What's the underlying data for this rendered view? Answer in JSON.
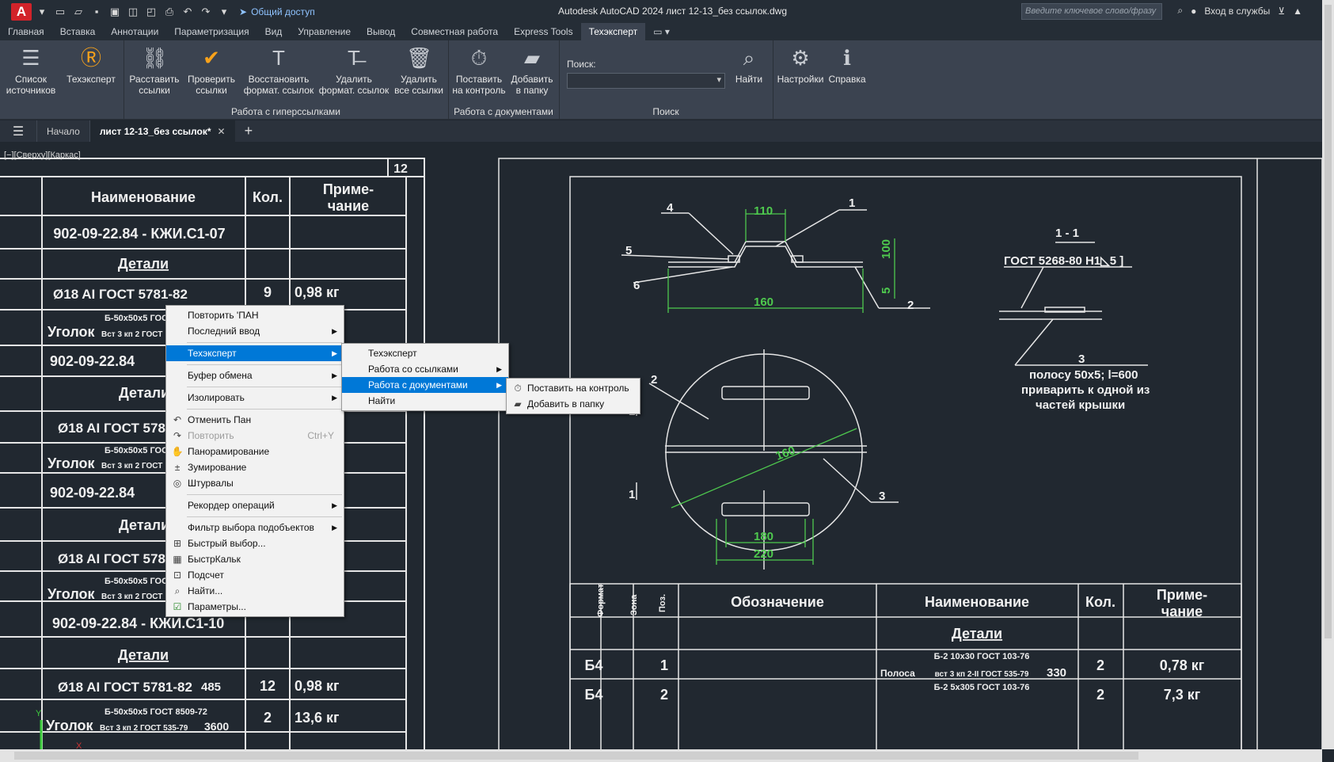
{
  "titlebar": {
    "logo": "A",
    "share_label": "Общий доступ",
    "title": "Autodesk AutoCAD 2024   лист 12-13_без ссылок.dwg",
    "search_placeholder": "Введите ключевое слово/фразу",
    "signin_label": "Вход в службы"
  },
  "ribbon_tabs": [
    "Главная",
    "Вставка",
    "Аннотации",
    "Параметризация",
    "Вид",
    "Управление",
    "Вывод",
    "Совместная работа",
    "Express Tools",
    "Техэксперт"
  ],
  "ribbon_active_tab": "Техэксперт",
  "ribbon": {
    "buttons": [
      {
        "label1": "Список",
        "label2": "источников",
        "icon": "list-icon"
      },
      {
        "label1": "Техэксперт",
        "label2": "",
        "icon": "techexpert-logo-icon"
      },
      {
        "label1": "Расставить",
        "label2": "ссылки",
        "icon": "link-icon"
      },
      {
        "label1": "Проверить",
        "label2": "ссылки",
        "icon": "check-icon"
      },
      {
        "label1": "Восстановить",
        "label2": "формат. ссылок",
        "icon": "text-format-icon"
      },
      {
        "label1": "Удалить",
        "label2": "формат. ссылок",
        "icon": "text-remove-icon"
      },
      {
        "label1": "Удалить",
        "label2": "все ссылки",
        "icon": "trash-icon"
      },
      {
        "label1": "Поставить",
        "label2": "на контроль",
        "icon": "stopwatch-icon"
      },
      {
        "label1": "Добавить",
        "label2": "в папку",
        "icon": "folder-icon"
      },
      {
        "label1": "Найти",
        "label2": "",
        "icon": "magnifier-icon"
      },
      {
        "label1": "Настройки",
        "label2": "",
        "icon": "gear-icon"
      },
      {
        "label1": "Справка",
        "label2": "",
        "icon": "info-icon"
      }
    ],
    "panels": [
      "Работа с гиперссылками",
      "Работа с документами",
      "Поиск"
    ],
    "search_label": "Поиск:"
  },
  "file_tabs": {
    "start": "Начало",
    "active": "лист 12-13_без ссылок*"
  },
  "viewport_label": "[−][Сверху][Каркас]",
  "drawing": {
    "page_number": "12",
    "left_table": {
      "header": [
        "Наименование",
        "Кол.",
        "Приме-",
        "чание"
      ],
      "rows": [
        "902-09-22.84  - КЖИ.С1-07",
        "Детали",
        "Ø18 AI ГОСТ 5781-82",
        "9",
        "0,98 кг",
        "Б-50х50х5 ГОСТ",
        "Уголок",
        "Вст 3 кп 2 ГОСТ",
        "902-09-22.84",
        "Детали",
        "Ø18 AI ГОСТ 5781",
        "Б-50х50х5 ГОС",
        "Уголок",
        "Вст 3 кп 2 ГОСТ",
        "902-09-22.84",
        "Детали",
        "Ø18 AI ГОСТ 5781",
        "Б-50х50х5 ГОС",
        "Уголок",
        "Вст 3 кп 2 ГОСТ",
        "902-09-22.84  - КЖИ.С1-10",
        "Детали",
        "Ø18 AI ГОСТ 5781-82",
        "12",
        "0,98 кг",
        "Б-50х50х5 ГОСТ 8509-72",
        "Уголок",
        "Вст 3 кп 2 ГОСТ 535-79",
        "2",
        "13,6 кг",
        "485",
        "3600"
      ]
    },
    "callouts": [
      "4",
      "1",
      "5",
      "6",
      "2",
      "1 - 1",
      "ГОСТ 5268-80 Н1◺5 ]",
      "3",
      "полосу 50х5; l=600",
      "приварить к одной из",
      "частей крышки",
      "2",
      "1",
      "1",
      "3"
    ],
    "dims": [
      "110",
      "160",
      "100",
      "5",
      "160",
      "180",
      "220"
    ],
    "right_table": {
      "header": [
        "Формат",
        "Зона",
        "Поз.",
        "Обозначение",
        "Наименование",
        "Кол.",
        "Приме-",
        "чание"
      ],
      "section": "Детали",
      "rows": [
        {
          "format": "Б4",
          "pos": "1",
          "name_top": "Б-2 10х30 ГОСТ 103-76",
          "name_label": "Полоса",
          "name_bottom": "вст 3 кп 2-II ГОСТ 535-79",
          "len": "330",
          "qty": "2",
          "note": "0,78 кг"
        },
        {
          "format": "Б4",
          "pos": "2",
          "name_top": "Б-2 5х305 ГОСТ 103-76",
          "qty": "2",
          "note": "7,3 кг"
        }
      ]
    }
  },
  "context_menu": {
    "items": [
      {
        "label": "Повторить 'ПАН"
      },
      {
        "label": "Последний ввод",
        "sub": true
      },
      {
        "sep": true
      },
      {
        "label": "Техэксперт",
        "sub": true,
        "selected": true
      },
      {
        "sep": true
      },
      {
        "label": "Буфер обмена",
        "sub": true
      },
      {
        "sep": true
      },
      {
        "label": "Изолировать",
        "sub": true
      },
      {
        "sep": true
      },
      {
        "label": "Отменить Пан",
        "icon": "undo-icon"
      },
      {
        "label": "Повторить",
        "shortcut": "Ctrl+Y",
        "disabled": true,
        "icon": "redo-icon"
      },
      {
        "label": "Панорамирование",
        "icon": "pan-hand-icon"
      },
      {
        "label": "Зумирование",
        "icon": "zoom-icon"
      },
      {
        "label": "Штурвалы",
        "icon": "steering-wheel-icon"
      },
      {
        "sep": true
      },
      {
        "label": "Рекордер операций",
        "sub": true
      },
      {
        "sep": true
      },
      {
        "label": "Фильтр выбора подобъектов",
        "sub": true
      },
      {
        "label": "Быстрый выбор...",
        "icon": "quick-select-icon"
      },
      {
        "label": "БыстрКальк",
        "icon": "calculator-icon"
      },
      {
        "label": "Подсчет",
        "icon": "count-icon"
      },
      {
        "label": "Найти...",
        "icon": "find-icon"
      },
      {
        "label": "Параметры...",
        "icon": "options-check-icon"
      }
    ]
  },
  "submenu_techexpert": {
    "items": [
      {
        "label": "Техэксперт"
      },
      {
        "label": "Работа со ссылками",
        "sub": true
      },
      {
        "label": "Работа с документами",
        "sub": true,
        "selected": true
      },
      {
        "label": "Найти"
      }
    ]
  },
  "submenu_documents": {
    "items": [
      {
        "label": "Поставить на контроль",
        "icon": "stopwatch-icon"
      },
      {
        "label": "Добавить в папку",
        "icon": "folder-icon"
      }
    ]
  },
  "colors": {
    "background": "#212830",
    "ribbon": "#3b4350",
    "accent_orange": "#f7a21b",
    "dimension_green": "#4ec94e",
    "selection_blue": "#0078d7"
  }
}
